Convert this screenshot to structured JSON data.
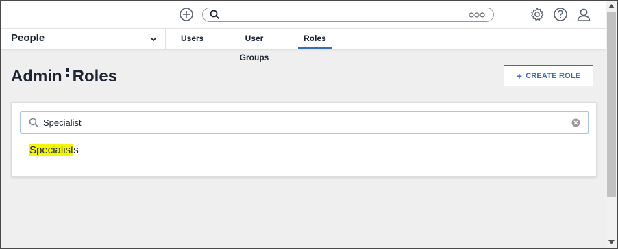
{
  "topbar": {
    "icons": [
      "add-circle-icon",
      "search-icon",
      "more-icon",
      "gear-icon",
      "help-icon",
      "user-icon"
    ]
  },
  "nav": {
    "module": "People",
    "tabs": [
      {
        "label": "Users",
        "active": false
      },
      {
        "label": "User Groups",
        "active": false
      },
      {
        "label": "Roles",
        "active": true
      }
    ],
    "active_color": "#3a6cb0"
  },
  "page": {
    "title_left": "Admin",
    "title_right": "Roles",
    "create_button": "CREATE ROLE"
  },
  "search": {
    "value": "Specialist"
  },
  "results": [
    {
      "highlight": "Specialist",
      "rest": "s"
    }
  ],
  "colors": {
    "accent": "#3a6cb0",
    "highlight": "#f4f600",
    "text": "#1b2532"
  }
}
